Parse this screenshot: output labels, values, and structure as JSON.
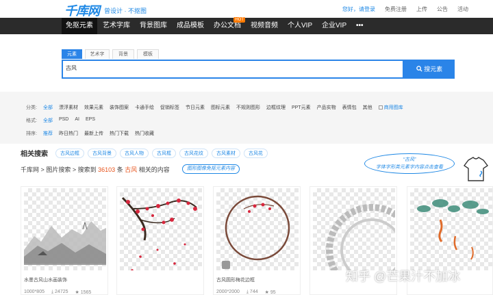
{
  "header": {
    "logo": "千库网",
    "slogan": "曾设计 · 不抠图",
    "links": [
      "您好，请登录",
      "免费注册",
      "上传",
      "公告",
      "活动"
    ]
  },
  "nav": {
    "items": [
      "免抠元素",
      "艺术字库",
      "背景图库",
      "成品模板",
      "办公文档",
      "视频音频",
      "个人VIP",
      "企业VIP",
      "•••"
    ],
    "hot_badge": "HOT"
  },
  "search": {
    "tabs": [
      "元素",
      "艺术字",
      "背景",
      "模板"
    ],
    "value": "古风",
    "button": "搜元素"
  },
  "filters": {
    "category_label": "分类:",
    "categories": [
      "全部",
      "漂浮素材",
      "效果元素",
      "装饰图案",
      "卡通手绘",
      "促销标签",
      "节日元素",
      "图标元素",
      "不规则图形",
      "边框纹理",
      "PPT元素",
      "产品实物",
      "表情包",
      "其他"
    ],
    "commercial": "商用图库",
    "format_label": "格式:",
    "formats": [
      "全部",
      "PSD",
      "AI",
      "EPS"
    ],
    "sort_label": "排序:",
    "sorts": [
      "推荐",
      "昨日热门",
      "最新上传",
      "热门下载",
      "热门收藏"
    ]
  },
  "related": {
    "title": "相关搜索",
    "tags": [
      "古风边框",
      "古风背景",
      "古风人物",
      "古风框",
      "古风花纹",
      "古风素材",
      "古风花"
    ]
  },
  "breadcrumb": {
    "home": "千库网",
    "sep": ">",
    "section": "图片搜索",
    "prefix": "搜索到",
    "count": "36103",
    "unit": "条",
    "keyword": "古风",
    "suffix": "相关的内容"
  },
  "annotations": {
    "note1": "图形图像免抠元素内容",
    "bubble_title": "“古风”",
    "bubble_text": "字体字形类元素字内容点击查看"
  },
  "cards": [
    {
      "name": "水墨古风山水画装饰",
      "size": "1000*805",
      "downloads": "24725",
      "favs": "1565"
    },
    {
      "name": "",
      "size": "",
      "downloads": "",
      "favs": ""
    },
    {
      "name": "古风圆形梅花边框",
      "size": "2000*2000",
      "downloads": "744",
      "favs": "95"
    },
    {
      "name": "",
      "size": "",
      "downloads": "",
      "favs": ""
    },
    {
      "name": "",
      "size": "",
      "downloads": "",
      "favs": ""
    }
  ],
  "watermark": "知乎 @芒果汁不加冰",
  "colors": {
    "accent": "#2a84e8",
    "nav_bg": "#2b2b2b",
    "highlight": "#e8531b"
  }
}
